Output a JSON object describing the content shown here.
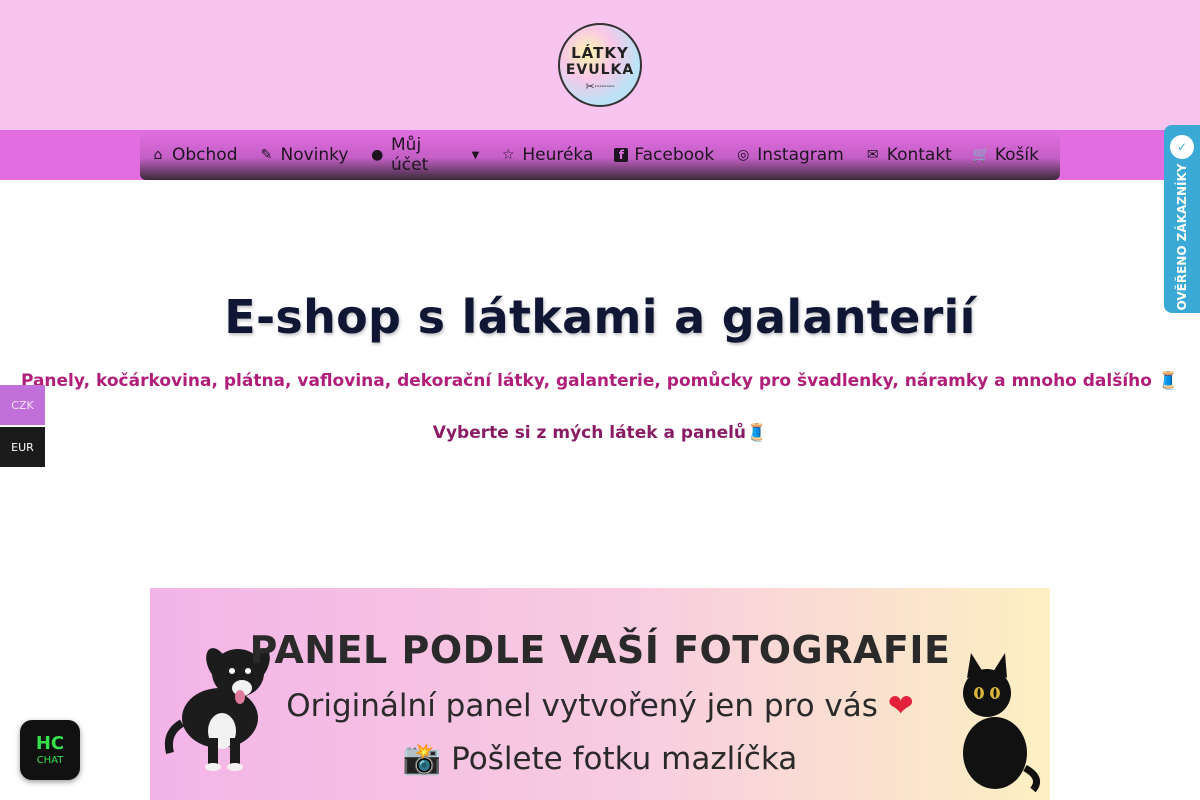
{
  "header": {
    "logo": {
      "line1": "LÁTKY",
      "line2": "EVULKA",
      "scissors": "✂┈┈┈"
    }
  },
  "nav": {
    "items": [
      {
        "label": "Obchod",
        "icon": "⌂",
        "icon_name": "home-icon"
      },
      {
        "label": "Novinky",
        "icon": "✎",
        "icon_name": "edit-icon"
      },
      {
        "label": "Můj účet",
        "icon": "●",
        "icon_name": "user-icon",
        "caret": "▼"
      },
      {
        "label": "Heuréka",
        "icon": "☆",
        "icon_name": "star-icon"
      },
      {
        "label": "Facebook",
        "icon": "f",
        "icon_name": "facebook-icon"
      },
      {
        "label": "Instagram",
        "icon": "◎",
        "icon_name": "instagram-icon"
      },
      {
        "label": "Kontakt",
        "icon": "✉",
        "icon_name": "mail-icon"
      },
      {
        "label": "Košík",
        "icon": "🛒",
        "icon_name": "cart-icon"
      }
    ]
  },
  "hero": {
    "title": "E-shop s látkami a galanterií",
    "subtitle": "Panely, kočárkovina, plátna, vaflovina, dekorační látky, galanterie, pomůcky pro švadlenky, náramky a mnoho dalšího 🧵",
    "cta": "Vyberte si z mých látek a panelů🧵"
  },
  "banner": {
    "title": "PANEL PODLE VAŠÍ FOTOGRAFIE",
    "line1": "Originální panel vytvořený jen pro vás",
    "heart": "❤",
    "line2": "📸 Pošlete fotku mazlíčka"
  },
  "currency": {
    "czk": "CZK",
    "eur": "EUR"
  },
  "verified": {
    "text": "OVĚŘENO ZÁKAZNÍKY",
    "badge": "✓"
  },
  "chat": {
    "brand": "HC",
    "label": "CHAT"
  },
  "colors": {
    "header_bg": "#f7c4f0",
    "nav_bg": "#e16de0",
    "title": "#101735",
    "accent": "#b01e79",
    "verified_bg": "#3aa9d6",
    "chat_green": "#35e04c"
  }
}
